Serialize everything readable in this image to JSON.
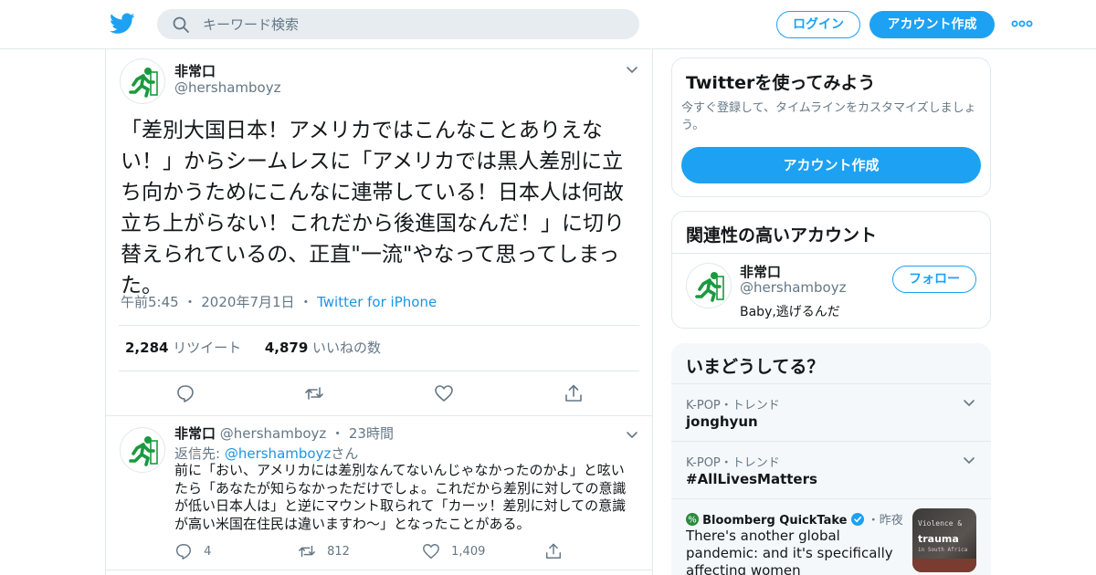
{
  "header": {
    "search_placeholder": "キーワード検索",
    "login_label": "ログイン",
    "signup_label": "アカウント作成"
  },
  "tweet": {
    "author_name": "非常口",
    "author_handle": "@hershamboyz",
    "text": "「差別大国日本！アメリカではこんなことありえない！」からシームレスに「アメリカでは黒人差別に立ち向かうためにこんなに連帯している！日本人は何故立ち上がらない！これだから後進国なんだ！」に切り替えられているの、正直\"一流\"やなって思ってしまった。",
    "time": "午前5:45",
    "date": "2020年7月1日",
    "source": "Twitter for iPhone",
    "retweet_count": "2,284",
    "retweet_label": "リツイート",
    "like_count": "4,879",
    "like_label": "いいねの数"
  },
  "reply": {
    "author_name": "非常口",
    "author_handle": "@hershamboyz",
    "age": "23時間",
    "reply_prefix": "返信先:",
    "reply_target": "@hershamboyz",
    "reply_suffix": "さん",
    "text": "前に「おい、アメリカには差別なんてないんじゃなかったのかよ」と呟いたら「あなたが知らなかっただけでしょ。これだから差別に対しての意識が低い日本人は」と逆にマウント取られて「カーッ！差別に対しての意識が高い米国在住民は違いますわ〜」となったことがある。",
    "reply_count": "4",
    "retweet_count": "812",
    "like_count": "1,409"
  },
  "signup_card": {
    "title": "Twitterを使ってみよう",
    "subtitle": "今すぐ登録して、タイムラインをカスタマイズしましょう。",
    "button_label": "アカウント作成"
  },
  "related_card": {
    "title": "関連性の高いアカウント",
    "name": "非常口",
    "handle": "@hershamboyz",
    "bio": "Baby,逃げるんだ",
    "follow_label": "フォロー"
  },
  "trends_card": {
    "title": "いまどうしてる？",
    "items": [
      {
        "category": "K-POP・トレンド",
        "name": "jonghyun"
      },
      {
        "category": "K-POP・トレンド",
        "name": "#AllLivesMatters"
      }
    ],
    "news": {
      "source": "Bloomberg QuickTake",
      "age": "昨夜",
      "headline": "There's another global pandemic: and it's specifically affecting women",
      "thumb_line1": "Violence &",
      "thumb_line2": "trauma",
      "thumb_line3": "in South Africa"
    }
  },
  "colors": {
    "accent": "#1da1f2",
    "exit_green": "#1a9a3e"
  }
}
